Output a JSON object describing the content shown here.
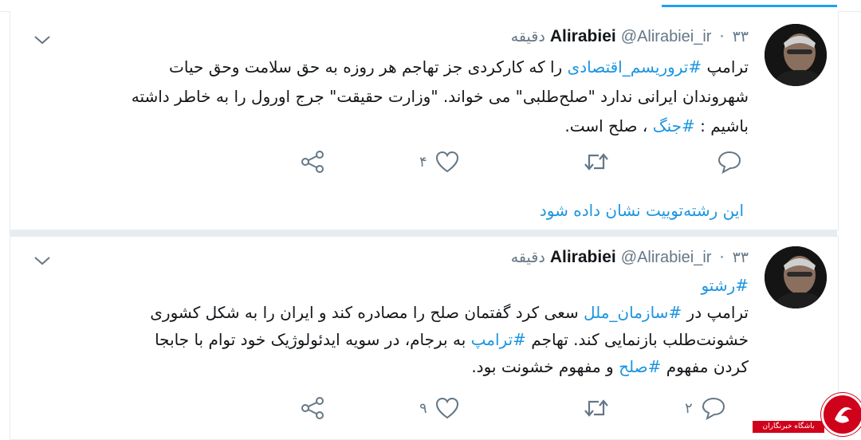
{
  "thread_link": "این رشته‌توییت نشان داده شود",
  "watermark": "باشگاه خبرنگاران",
  "colors": {
    "link": "#1b95e0",
    "icon": "#657786",
    "text": "#14171a",
    "accent": "#1da1f2",
    "badge": "#d0021b"
  },
  "tweets": [
    {
      "name": "Alirabiei",
      "handle": "@Alirabiei_ir",
      "separator": "·",
      "time": "۳۳ دقیقه",
      "body_lines": [
        [
          {
            "t": "ترامپ "
          },
          {
            "t": "#تروریسم_اقتصادی",
            "tag": true
          },
          {
            "t": " را که کارکردی جز تهاجم هر روزه به حق سلامت وحق حیات"
          }
        ],
        [
          {
            "t": "شهروندان ایرانی ندارد \"صلح‌طلبی\" می خواند. \"وزارت حقیقت\" جرج اورول را به  خاطر داشته"
          }
        ],
        [
          {
            "t": "باشیم : "
          },
          {
            "t": "#جنگ",
            "tag": true
          },
          {
            "t": " ، صلح است."
          }
        ]
      ],
      "reply_count": "",
      "retweet_count": "",
      "like_count": "۴"
    },
    {
      "name": "Alirabiei",
      "handle": "@Alirabiei_ir",
      "separator": "·",
      "time": "۳۳ دقیقه",
      "body_lines": [
        [
          {
            "t": "#رشتو",
            "tag": true
          }
        ],
        [
          {
            "t": "ترامپ در "
          },
          {
            "t": "#سازمان_ملل",
            "tag": true
          },
          {
            "t": " سعی کرد گفتمان صلح را مصادره کند و ایران را به شکل کشوری"
          }
        ],
        [
          {
            "t": "خشونت‌طلب بازنمایی کند. تهاجم "
          },
          {
            "t": "#ترامپ",
            "tag": true
          },
          {
            "t": " به برجام، در سویه ایدئولوژیک خود توام با جابجا"
          }
        ],
        [
          {
            "t": "کردن مفهوم "
          },
          {
            "t": "#صلح",
            "tag": true
          },
          {
            "t": " و مفهوم خشونت بود."
          }
        ]
      ],
      "reply_count": "۲",
      "retweet_count": "",
      "like_count": "۹"
    }
  ]
}
